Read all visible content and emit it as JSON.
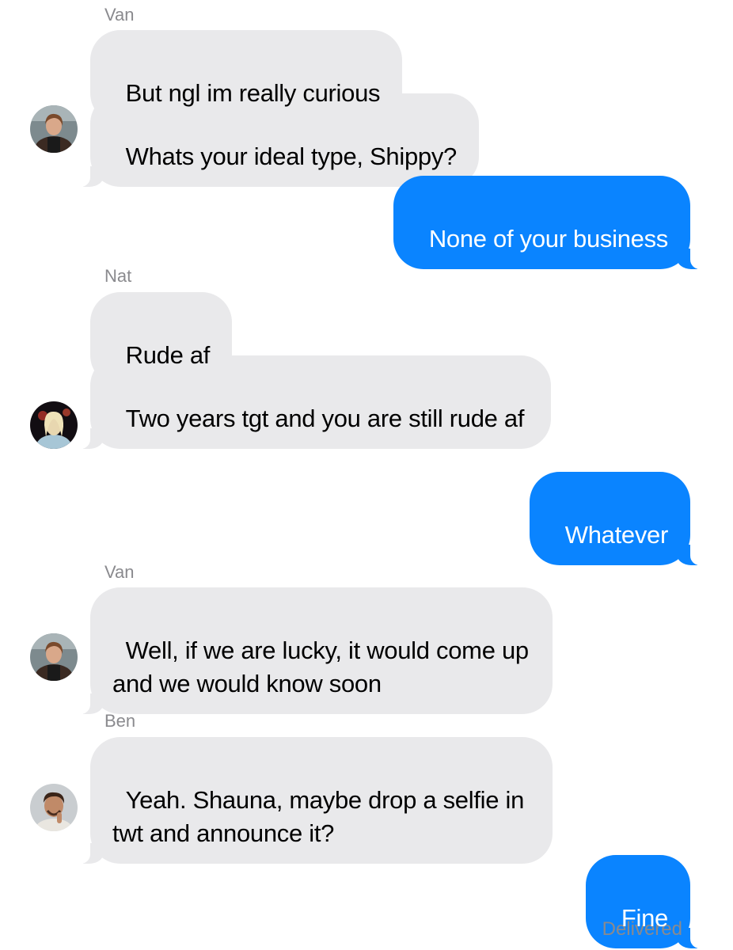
{
  "conversation": {
    "messages": [
      {
        "sender": "Van",
        "text": "But ngl im really curious",
        "direction": "incoming"
      },
      {
        "sender": "Van",
        "text": "Whats your ideal type, Shippy?",
        "direction": "incoming"
      },
      {
        "sender": "me",
        "text": "None of your business",
        "direction": "outgoing"
      },
      {
        "sender": "Nat",
        "text": "Rude af",
        "direction": "incoming"
      },
      {
        "sender": "Nat",
        "text": "Two years tgt and you are still rude af",
        "direction": "incoming"
      },
      {
        "sender": "me",
        "text": "Whatever",
        "direction": "outgoing"
      },
      {
        "sender": "Van",
        "text": "Well, if we are lucky, it would come up and we would know soon",
        "direction": "incoming"
      },
      {
        "sender": "Ben",
        "text": "Yeah. Shauna, maybe drop a selfie in twt and announce it?",
        "direction": "incoming"
      },
      {
        "sender": "me",
        "text": "Fine",
        "direction": "outgoing"
      }
    ],
    "sender_labels": [
      "Van",
      "Nat",
      "Van",
      "Ben"
    ],
    "status": "Delivered"
  },
  "colors": {
    "incoming_bubble": "#e9e9eb",
    "outgoing_bubble": "#0a84ff",
    "sender_label": "#8a8a8e"
  },
  "avatars": [
    "van-avatar-icon",
    "nat-avatar-icon",
    "van-avatar-icon",
    "ben-avatar-icon"
  ]
}
